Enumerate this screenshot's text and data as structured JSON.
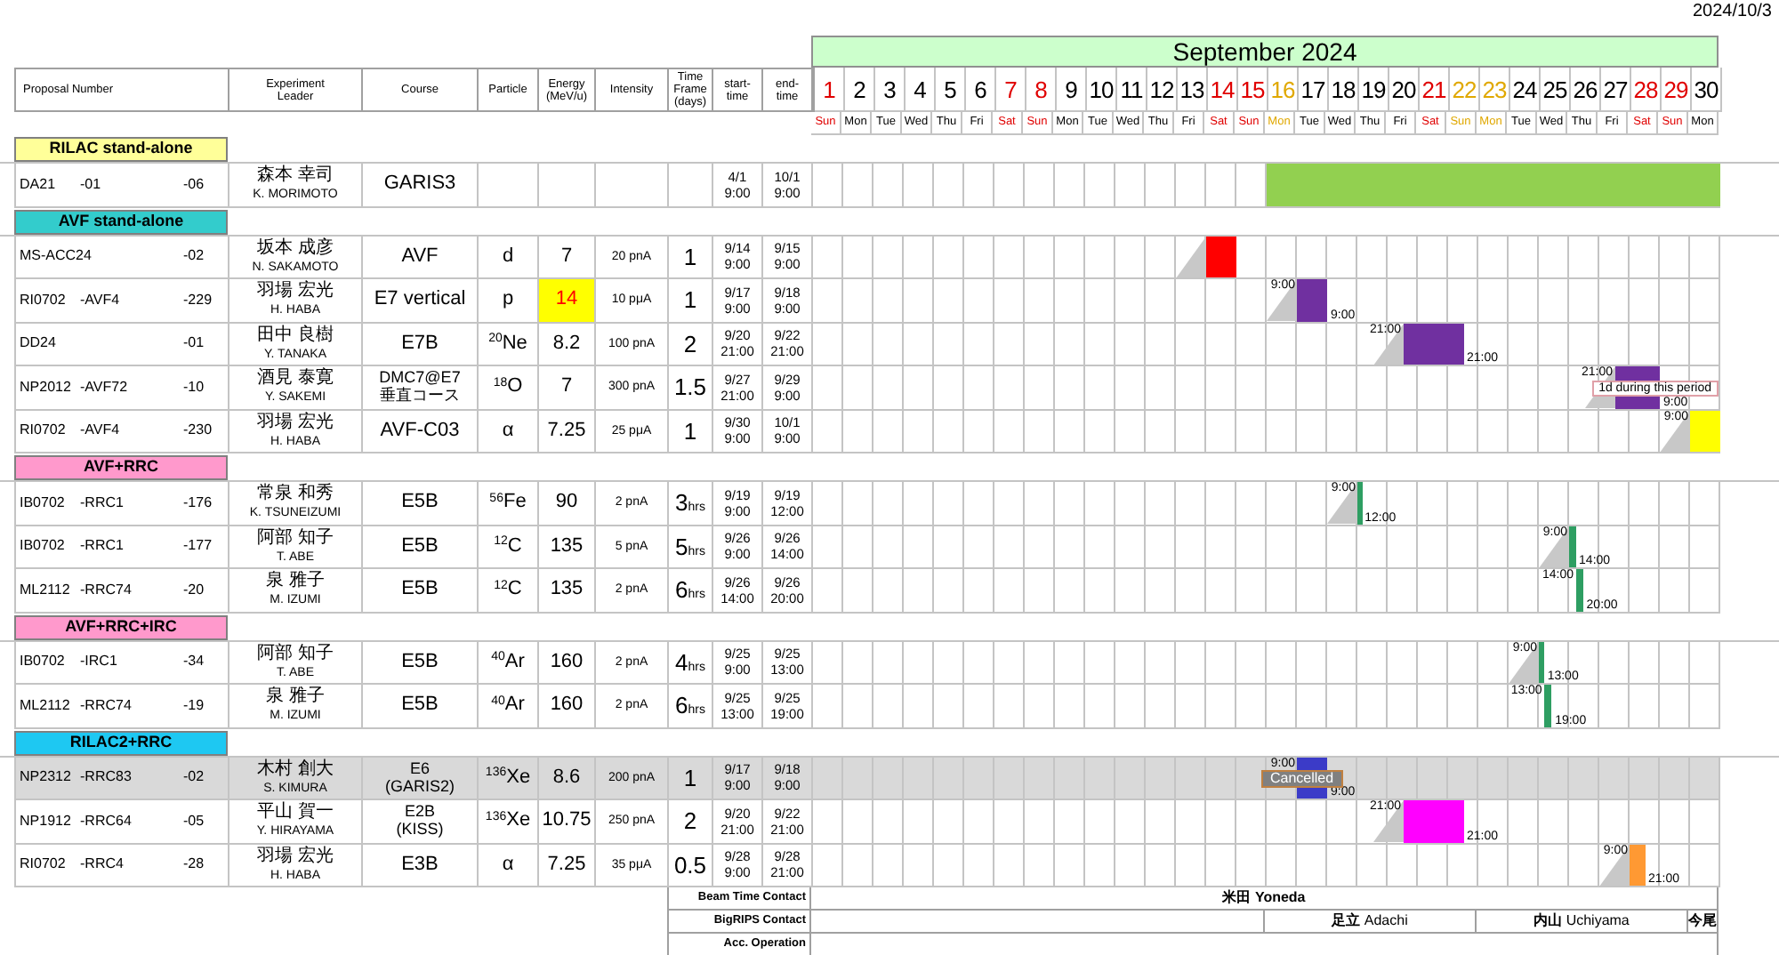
{
  "date": "2024/10/3",
  "calendar": {
    "title": "September 2024",
    "days": [
      {
        "day": "1",
        "weekday": "Sun",
        "color": "#e00000"
      },
      {
        "day": "2",
        "weekday": "Mon",
        "color": "#000000"
      },
      {
        "day": "3",
        "weekday": "Tue",
        "color": "#000000"
      },
      {
        "day": "4",
        "weekday": "Wed",
        "color": "#000000"
      },
      {
        "day": "5",
        "weekday": "Thu",
        "color": "#000000"
      },
      {
        "day": "6",
        "weekday": "Fri",
        "color": "#000000"
      },
      {
        "day": "7",
        "weekday": "Sat",
        "color": "#e00000"
      },
      {
        "day": "8",
        "weekday": "Sun",
        "color": "#e00000"
      },
      {
        "day": "9",
        "weekday": "Mon",
        "color": "#000000"
      },
      {
        "day": "10",
        "weekday": "Tue",
        "color": "#000000"
      },
      {
        "day": "11",
        "weekday": "Wed",
        "color": "#000000"
      },
      {
        "day": "12",
        "weekday": "Thu",
        "color": "#000000"
      },
      {
        "day": "13",
        "weekday": "Fri",
        "color": "#000000"
      },
      {
        "day": "14",
        "weekday": "Sat",
        "color": "#e00000"
      },
      {
        "day": "15",
        "weekday": "Sun",
        "color": "#e00000"
      },
      {
        "day": "16",
        "weekday": "Mon",
        "color": "#e0a800"
      },
      {
        "day": "17",
        "weekday": "Tue",
        "color": "#000000"
      },
      {
        "day": "18",
        "weekday": "Wed",
        "color": "#000000"
      },
      {
        "day": "19",
        "weekday": "Thu",
        "color": "#000000"
      },
      {
        "day": "20",
        "weekday": "Fri",
        "color": "#000000"
      },
      {
        "day": "21",
        "weekday": "Sat",
        "color": "#e00000"
      },
      {
        "day": "22",
        "weekday": "Sun",
        "color": "#e0a800"
      },
      {
        "day": "23",
        "weekday": "Mon",
        "color": "#e0a800"
      },
      {
        "day": "24",
        "weekday": "Tue",
        "color": "#000000"
      },
      {
        "day": "25",
        "weekday": "Wed",
        "color": "#000000"
      },
      {
        "day": "26",
        "weekday": "Thu",
        "color": "#000000"
      },
      {
        "day": "27",
        "weekday": "Fri",
        "color": "#000000"
      },
      {
        "day": "28",
        "weekday": "Sat",
        "color": "#e00000"
      },
      {
        "day": "29",
        "weekday": "Sun",
        "color": "#e00000"
      },
      {
        "day": "30",
        "weekday": "Mon",
        "color": "#000000"
      }
    ]
  },
  "columns": [
    "Proposal Number",
    "Experiment\nLeader",
    "Course",
    "Particle",
    "Energy\n(MeV/u)",
    "Intensity",
    "Time\nFrame\n(days)",
    "start-\ntime",
    "end-\ntime"
  ],
  "groups": [
    {
      "title": "RILAC stand-alone",
      "color": "#ffff99",
      "rows": [
        {
          "proposal": {
            "code": "DA21",
            "sub": "-01",
            "number": "-06"
          },
          "leader": [
            "森本 幸司",
            "K. MORIMOTO"
          ],
          "course": [
            "GARIS3"
          ],
          "start": [
            "4/1",
            "9:00"
          ],
          "end": [
            "10/1",
            "9:00"
          ],
          "cancelled": false,
          "bar": {
            "color": "#92d050",
            "level": 0.5,
            "ramp": false
          }
        }
      ]
    },
    {
      "title": "AVF stand-alone",
      "color": "#33cccc",
      "rows": [
        {
          "proposal": {
            "code": "MS-ACC24",
            "number": "-02"
          },
          "leader": [
            "坂本 成彦",
            "N. SAKAMOTO"
          ],
          "course": [
            "AVF"
          ],
          "particle": "d",
          "energy": "7",
          "highlight": false,
          "intensity": "20 pnA",
          "time_frame": "1",
          "start": [
            "9/14",
            "9:00"
          ],
          "end": [
            "9/15",
            "9:00"
          ],
          "cancelled": false,
          "bar": {
            "color": "#ff0000",
            "ramp": true
          }
        },
        {
          "proposal": {
            "code": "RI0702",
            "sub": "-AVF4",
            "number": "-229"
          },
          "leader": [
            "羽場 宏光",
            "H. HABA"
          ],
          "course": [
            "E7 vertical"
          ],
          "particle": "p",
          "energy": "14",
          "highlight": true,
          "intensity": "10 pμA",
          "time_frame": "1",
          "start": [
            "9/17",
            "9:00"
          ],
          "end": [
            "9/18",
            "9:00"
          ],
          "cancelled": false,
          "bar": {
            "color": "#7030a0",
            "ramp": true,
            "start_mark": "9:00",
            "end_mark": "9:00"
          }
        },
        {
          "proposal": {
            "code": "DD24",
            "number": "-01"
          },
          "leader": [
            "田中 良樹",
            "Y. TANAKA"
          ],
          "course": [
            "E7B"
          ],
          "particle": "$^{20}$Ne",
          "energy": "8.2",
          "highlight": false,
          "intensity": "100 pnA",
          "time_frame": "2",
          "start": [
            "9/20",
            "21:00"
          ],
          "end": [
            "9/22",
            "21:00"
          ],
          "cancelled": false,
          "bar": {
            "color": "#7030a0",
            "ramp": true,
            "start_mark": "21:00",
            "end_mark": "21:00"
          }
        },
        {
          "proposal": {
            "code": "NP2012",
            "sub": "-AVF72",
            "number": "-10"
          },
          "leader": [
            "酒見 泰寛",
            "Y. SAKEMI"
          ],
          "course": [
            "DMC7@E7",
            "垂直コース"
          ],
          "particle": "$^{18}$O",
          "energy": "7",
          "highlight": false,
          "intensity": "300 pnA",
          "time_frame": "1.5",
          "start": [
            "9/27",
            "21:00"
          ],
          "end": [
            "9/29",
            "9:00"
          ],
          "cancelled": false,
          "bar": {
            "color": "#7030a0",
            "ramp": true,
            "start_mark": "21:00",
            "end_mark": "9:00"
          },
          "note": "1d during this period"
        },
        {
          "proposal": {
            "code": "RI0702",
            "sub": "-AVF4",
            "number": "-230"
          },
          "leader": [
            "羽場 宏光",
            "H. HABA"
          ],
          "course": [
            "AVF-C03"
          ],
          "particle": "α",
          "energy": "7.25",
          "highlight": false,
          "intensity": "25 pμA",
          "time_frame": "1",
          "start": [
            "9/30",
            "9:00"
          ],
          "end": [
            "10/1",
            "9:00"
          ],
          "cancelled": false,
          "bar": {
            "color": "#ffff00",
            "ramp": true,
            "start_mark": "9:00"
          }
        }
      ]
    },
    {
      "title": "AVF+RRC",
      "color": "#ff99cc",
      "rows": [
        {
          "proposal": {
            "code": "IB0702",
            "sub": "-RRC1",
            "number": "-176"
          },
          "leader": [
            "常泉 和秀",
            "K. TSUNEIZUMI"
          ],
          "course": [
            "E5B"
          ],
          "particle": "$^{56}$Fe",
          "energy": "90",
          "highlight": false,
          "intensity": "2 pnA",
          "time_frame": "3",
          "time_unit": "hrs",
          "start": [
            "9/19",
            "9:00"
          ],
          "end": [
            "9/19",
            "12:00"
          ],
          "cancelled": false,
          "bar": {
            "color": "#2e9e62",
            "ramp": true,
            "start_mark": "9:00",
            "end_mark": "12:00"
          }
        },
        {
          "proposal": {
            "code": "IB0702",
            "sub": "-RRC1",
            "number": "-177"
          },
          "leader": [
            "阿部 知子",
            "T. ABE"
          ],
          "course": [
            "E5B"
          ],
          "particle": "$^{12}$C",
          "energy": "135",
          "highlight": false,
          "intensity": "5 pnA",
          "time_frame": "5",
          "time_unit": "hrs",
          "start": [
            "9/26",
            "9:00"
          ],
          "end": [
            "9/26",
            "14:00"
          ],
          "cancelled": false,
          "bar": {
            "color": "#2e9e62",
            "ramp": true,
            "start_mark": "9:00",
            "end_mark": "14:00"
          }
        },
        {
          "proposal": {
            "code": "ML2112",
            "sub": "-RRC74",
            "number": "-20"
          },
          "leader": [
            "泉 雅子",
            "M. IZUMI"
          ],
          "course": [
            "E5B"
          ],
          "particle": "$^{12}$C",
          "energy": "135",
          "highlight": false,
          "intensity": "2 pnA",
          "time_frame": "6",
          "time_unit": "hrs",
          "start": [
            "9/26",
            "14:00"
          ],
          "end": [
            "9/26",
            "20:00"
          ],
          "cancelled": false,
          "bar": {
            "color": "#2e9e62",
            "ramp": false,
            "start_mark": "14:00",
            "end_mark": "20:00"
          }
        }
      ]
    },
    {
      "title": "AVF+RRC+IRC",
      "color": "#ff99cc",
      "rows": [
        {
          "proposal": {
            "code": "IB0702",
            "sub": "-IRC1",
            "number": "-34"
          },
          "leader": [
            "阿部 知子",
            "T. ABE"
          ],
          "course": [
            "E5B"
          ],
          "particle": "$^{40}$Ar",
          "energy": "160",
          "highlight": false,
          "intensity": "2 pnA",
          "time_frame": "4",
          "time_unit": "hrs",
          "start": [
            "9/25",
            "9:00"
          ],
          "end": [
            "9/25",
            "13:00"
          ],
          "cancelled": false,
          "bar": {
            "color": "#2e9e62",
            "ramp": true,
            "start_mark": "9:00",
            "end_mark": "13:00"
          }
        },
        {
          "proposal": {
            "code": "ML2112",
            "sub": "-RRC74",
            "number": "-19"
          },
          "leader": [
            "泉 雅子",
            "M. IZUMI"
          ],
          "course": [
            "E5B"
          ],
          "particle": "$^{40}$Ar",
          "energy": "160",
          "highlight": false,
          "intensity": "2 pnA",
          "time_frame": "6",
          "time_unit": "hrs",
          "start": [
            "9/25",
            "13:00"
          ],
          "end": [
            "9/25",
            "19:00"
          ],
          "cancelled": false,
          "bar": {
            "color": "#2e9e62",
            "ramp": false,
            "start_mark": "13:00",
            "end_mark": "19:00"
          }
        }
      ]
    },
    {
      "title": "RILAC2+RRC",
      "color": "#1ec8f2",
      "rows": [
        {
          "proposal": {
            "code": "NP2312",
            "sub": "-RRC83",
            "number": "-02"
          },
          "leader": [
            "木村 創大",
            "S. KIMURA"
          ],
          "course": [
            "E6",
            "(GARIS2)"
          ],
          "particle": "$^{136}$Xe",
          "energy": "8.6",
          "highlight": false,
          "intensity": "200 pnA",
          "time_frame": "1",
          "start": [
            "9/17",
            "9:00"
          ],
          "end": [
            "9/18",
            "9:00"
          ],
          "cancelled": true,
          "bar": {
            "color": "#3b3bc8",
            "ramp": false,
            "start_mark": "9:00",
            "end_mark": "9:00",
            "overlay": "Cancelled"
          }
        },
        {
          "proposal": {
            "code": "NP1912",
            "sub": "-RRC64",
            "number": "-05"
          },
          "leader": [
            "平山 賀一",
            "Y. HIRAYAMA"
          ],
          "course": [
            "E2B",
            "(KISS)"
          ],
          "particle": "$^{136}$Xe",
          "energy": "10.75",
          "highlight": false,
          "intensity": "250 pnA",
          "time_frame": "2",
          "start": [
            "9/20",
            "21:00"
          ],
          "end": [
            "9/22",
            "21:00"
          ],
          "cancelled": false,
          "bar": {
            "color": "#ff00ff",
            "ramp": true,
            "start_mark": "21:00",
            "end_mark": "21:00"
          }
        },
        {
          "proposal": {
            "code": "RI0702",
            "sub": "-RRC4",
            "number": "-28"
          },
          "leader": [
            "羽場 宏光",
            "H. HABA"
          ],
          "course": [
            "E3B"
          ],
          "particle": "α",
          "energy": "7.25",
          "highlight": false,
          "intensity": "35 pμA",
          "time_frame": "0.5",
          "start": [
            "9/28",
            "9:00"
          ],
          "end": [
            "9/28",
            "21:00"
          ],
          "cancelled": false,
          "bar": {
            "color": "#ff9933",
            "ramp": true,
            "start_mark": "9:00",
            "end_mark": "21:00"
          }
        }
      ]
    }
  ],
  "contacts": [
    {
      "label": "Beam Time Contact",
      "segments": [
        {
          "text": "米田 Yoneda",
          "bold": true
        }
      ]
    },
    {
      "label": "BigRIPS Contact",
      "segments": [
        {
          "text": "**足立** Adachi",
          "bold": false
        },
        {
          "text": "**内山** Uchiyama",
          "bold": false
        },
        {
          "text": "今尾",
          "bold": true
        }
      ]
    },
    {
      "label": "Acc. Operation"
    }
  ]
}
